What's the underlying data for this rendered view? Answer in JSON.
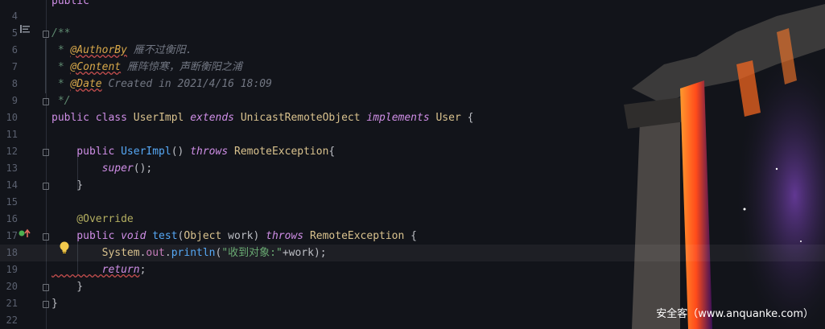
{
  "editor": {
    "lines": [
      {
        "num": "",
        "tokens": [
          {
            "t": "public",
            "c": "kw"
          }
        ]
      },
      {
        "num": "4",
        "tokens": []
      },
      {
        "num": "5",
        "tokens": [
          {
            "t": "/**",
            "c": "doc"
          }
        ]
      },
      {
        "num": "6",
        "tokens": [
          {
            "t": " * ",
            "c": "doc"
          },
          {
            "t": "@AuthorBy",
            "c": "doctag"
          },
          {
            "t": " 雁不过衡阳.",
            "c": "docval"
          }
        ]
      },
      {
        "num": "7",
        "tokens": [
          {
            "t": " * ",
            "c": "doc"
          },
          {
            "t": "@Content",
            "c": "doctag"
          },
          {
            "t": " 雁阵惊寒，声断衡阳之浦",
            "c": "docval"
          }
        ]
      },
      {
        "num": "8",
        "tokens": [
          {
            "t": " * ",
            "c": "doc"
          },
          {
            "t": "@Date",
            "c": "doctag"
          },
          {
            "t": " Created in 2021/4/16 18:09",
            "c": "docval"
          }
        ]
      },
      {
        "num": "9",
        "tokens": [
          {
            "t": " */",
            "c": "doc"
          }
        ]
      },
      {
        "num": "10",
        "tokens": [
          {
            "t": "public ",
            "c": "kw"
          },
          {
            "t": "class ",
            "c": "kw"
          },
          {
            "t": "UserImpl ",
            "c": "cls"
          },
          {
            "t": "extends ",
            "c": "kwi"
          },
          {
            "t": "UnicastRemoteObject ",
            "c": "cls"
          },
          {
            "t": "implements ",
            "c": "kwi"
          },
          {
            "t": "User",
            "c": "cls"
          },
          {
            "t": " {",
            "c": "plain"
          }
        ]
      },
      {
        "num": "11",
        "tokens": []
      },
      {
        "num": "12",
        "tokens": [
          {
            "t": "    public ",
            "c": "kw"
          },
          {
            "t": "UserImpl",
            "c": "fn"
          },
          {
            "t": "() ",
            "c": "plain"
          },
          {
            "t": "throws ",
            "c": "kwi"
          },
          {
            "t": "RemoteException",
            "c": "cls"
          },
          {
            "t": "{",
            "c": "plain"
          }
        ]
      },
      {
        "num": "13",
        "tokens": [
          {
            "t": "        super",
            "c": "kwi"
          },
          {
            "t": "();",
            "c": "plain"
          }
        ]
      },
      {
        "num": "14",
        "tokens": [
          {
            "t": "    }",
            "c": "plain"
          }
        ]
      },
      {
        "num": "15",
        "tokens": []
      },
      {
        "num": "16",
        "tokens": [
          {
            "t": "    @Override",
            "c": "anno"
          }
        ]
      },
      {
        "num": "17",
        "tokens": [
          {
            "t": "    public ",
            "c": "kw"
          },
          {
            "t": "void ",
            "c": "kwi"
          },
          {
            "t": "test",
            "c": "fn"
          },
          {
            "t": "(",
            "c": "plain"
          },
          {
            "t": "Object ",
            "c": "cls"
          },
          {
            "t": "work",
            "c": "plain"
          },
          {
            "t": ") ",
            "c": "plain"
          },
          {
            "t": "throws ",
            "c": "kwi"
          },
          {
            "t": "RemoteException",
            "c": "cls"
          },
          {
            "t": " {",
            "c": "plain"
          }
        ]
      },
      {
        "num": "18",
        "tokens": [
          {
            "t": "        System",
            "c": "cls"
          },
          {
            "t": ".",
            "c": "plain"
          },
          {
            "t": "out",
            "c": "fld"
          },
          {
            "t": ".",
            "c": "plain"
          },
          {
            "t": "println",
            "c": "fn"
          },
          {
            "t": "(",
            "c": "plain"
          },
          {
            "t": "\"收到对象:\"",
            "c": "str"
          },
          {
            "t": "+work);",
            "c": "plain"
          }
        ]
      },
      {
        "num": "19",
        "tokens": [
          {
            "t": "        return",
            "c": "kwi"
          },
          {
            "t": ";",
            "c": "plain"
          }
        ]
      },
      {
        "num": "20",
        "tokens": [
          {
            "t": "    }",
            "c": "plain"
          }
        ]
      },
      {
        "num": "21",
        "tokens": [
          {
            "t": "}",
            "c": "plain"
          }
        ]
      },
      {
        "num": "22",
        "tokens": []
      }
    ]
  },
  "watermark": "安全客（www.anquanke.com）",
  "colors": {
    "background": "#12141a",
    "keyword": "#cf8ee6",
    "class": "#d9c28e",
    "function": "#56a8f5",
    "string": "#6aab73",
    "annotation": "#b3ae60",
    "run_gutter": "#4caf50",
    "bulb": "#f2c94c"
  }
}
